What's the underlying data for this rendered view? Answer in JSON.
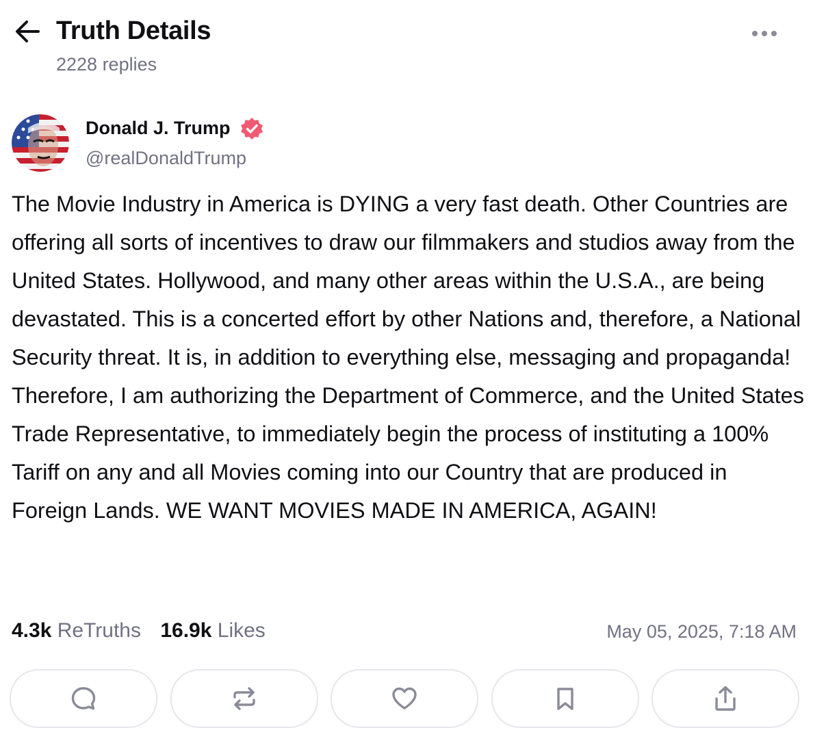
{
  "header": {
    "title": "Truth Details",
    "replies": "2228 replies"
  },
  "author": {
    "name": "Donald J. Trump",
    "handle": "@realDonaldTrump",
    "verified": true
  },
  "post": {
    "text": "The Movie Industry in America is DYING a very fast death. Other Countries are offering all sorts of incentives to draw our filmmakers and studios away from the United States. Hollywood, and many other areas within the U.S.A., are being devastated. This is a concerted effort by other Nations and, therefore, a National Security threat. It is, in addition to everything else, messaging and propaganda! Therefore, I am authorizing the Department of Commerce, and the United States Trade Representative, to immediately begin the process of instituting a 100% Tariff on any and all Movies coming into our Country that are produced in Foreign Lands. WE WANT MOVIES MADE IN AMERICA, AGAIN!"
  },
  "stats": {
    "retruths_count": "4.3k",
    "retruths_label": "ReTruths",
    "likes_count": "16.9k",
    "likes_label": "Likes",
    "timestamp": "May 05, 2025, 7:18 AM"
  },
  "actions": [
    "reply-icon",
    "retruth-icon",
    "like-icon",
    "bookmark-icon",
    "share-icon"
  ],
  "colors": {
    "text_primary": "#0f0f14",
    "text_secondary": "#717183",
    "verified_badge": "#f05a72",
    "button_border": "#e6e6ec",
    "icon": "#8a8a99"
  }
}
